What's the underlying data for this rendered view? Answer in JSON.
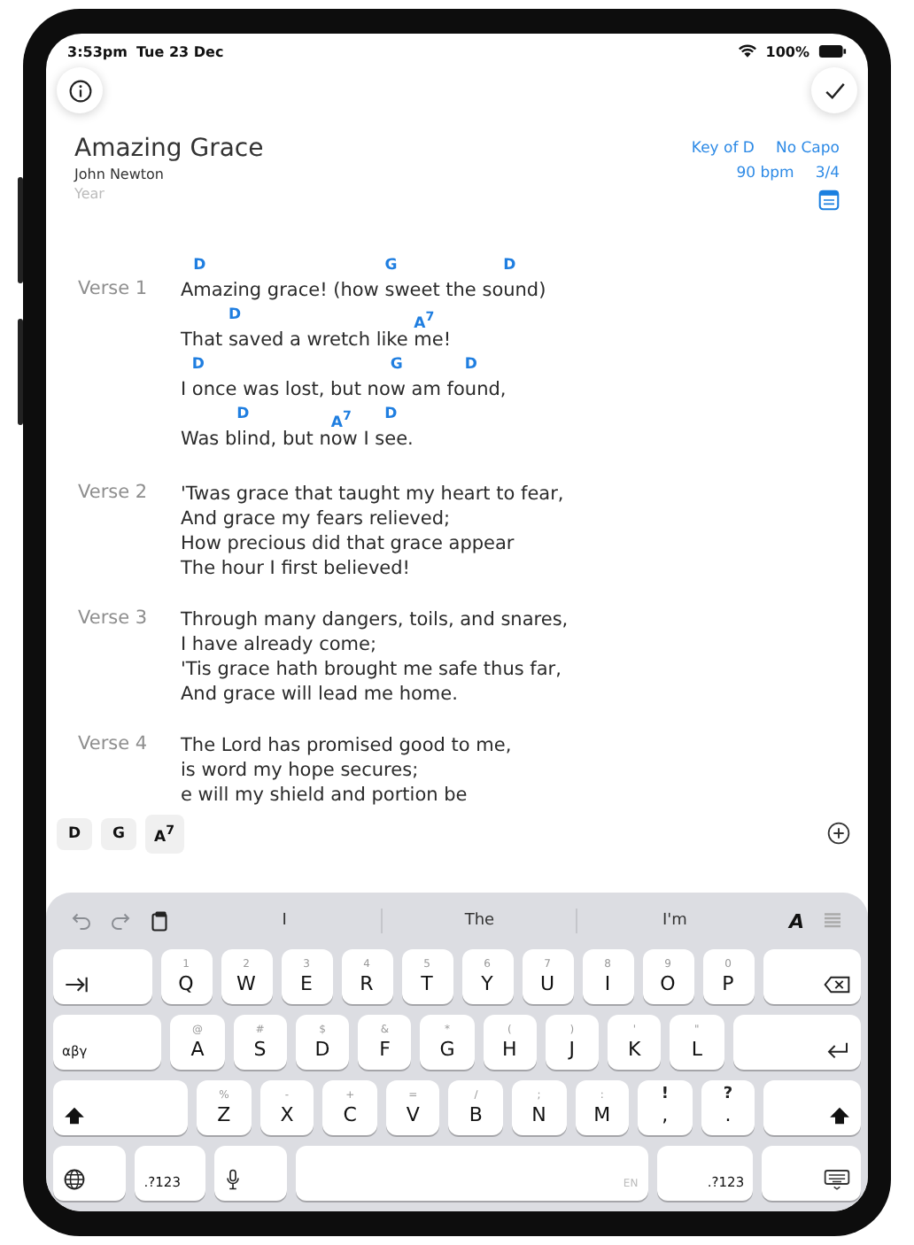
{
  "status_bar": {
    "time": "3:53pm",
    "date": "Tue 23 Dec",
    "battery": "100%"
  },
  "song": {
    "title": "Amazing Grace",
    "author": "John Newton",
    "year": {
      "placeholder": "Year"
    },
    "key": "Key of D",
    "capo": "No Capo",
    "tempo": "90 bpm",
    "time_signature": "3/4"
  },
  "sections": [
    {
      "label": "Verse 1",
      "lines": [
        {
          "segments": [
            {
              "text": "A"
            },
            {
              "chord": "D",
              "text": "mazing grace! (how "
            },
            {
              "chord": "G",
              "text": "sweet the so"
            },
            {
              "chord": "D",
              "text": "und)"
            }
          ]
        },
        {
          "segments": [
            {
              "text": "That "
            },
            {
              "chord": "D",
              "text": "saved a wretch like "
            },
            {
              "chord": "A$^{7}$",
              "text": "me!"
            }
          ]
        },
        {
          "segments": [
            {
              "text": "I "
            },
            {
              "chord": "D",
              "text": "once was lost, but no"
            },
            {
              "chord": "G",
              "text": "w am fo"
            },
            {
              "chord": "D",
              "text": "und,"
            }
          ]
        },
        {
          "segments": [
            {
              "text": "Was b"
            },
            {
              "chord": "D",
              "text": "lind, but n"
            },
            {
              "chord": "A$^{7}$",
              "text": "ow I s"
            },
            {
              "chord": "D",
              "text": "ee."
            }
          ]
        }
      ]
    },
    {
      "label": "Verse 2",
      "lines": [
        {
          "text": "'Twas grace that taught my heart to fear,"
        },
        {
          "text": "And grace my fears relieved;"
        },
        {
          "text": "How precious did that grace appear"
        },
        {
          "text": "The hour I first believed!"
        }
      ]
    },
    {
      "label": "Verse 3",
      "lines": [
        {
          "text": "Through many dangers, toils, and snares,"
        },
        {
          "text": "I have already come;"
        },
        {
          "text": "'Tis grace hath brought me safe thus far,"
        },
        {
          "text": "And grace will lead me home."
        }
      ]
    },
    {
      "label": "Verse 4",
      "lines": [
        {
          "text": "The Lord has promised good to me,"
        },
        {
          "text": "is word my hope secures;"
        },
        {
          "text": "e will my shield and portion be"
        }
      ]
    }
  ],
  "chord_bar": {
    "chords": [
      "D",
      "G",
      "A$^{7}$"
    ]
  },
  "keyboard": {
    "suggestions": [
      "I",
      "The",
      "I'm"
    ],
    "format_label": "A",
    "rows": [
      {
        "keys": [
          {
            "kind": "tab"
          },
          {
            "kind": "letter",
            "label": "Q",
            "alt": "1"
          },
          {
            "kind": "letter",
            "label": "W",
            "alt": "2"
          },
          {
            "kind": "letter",
            "label": "E",
            "alt": "3"
          },
          {
            "kind": "letter",
            "label": "R",
            "alt": "4"
          },
          {
            "kind": "letter",
            "label": "T",
            "alt": "5"
          },
          {
            "kind": "letter",
            "label": "Y",
            "alt": "6"
          },
          {
            "kind": "letter",
            "label": "U",
            "alt": "7"
          },
          {
            "kind": "letter",
            "label": "I",
            "alt": "8"
          },
          {
            "kind": "letter",
            "label": "O",
            "alt": "9"
          },
          {
            "kind": "letter",
            "label": "P",
            "alt": "0"
          },
          {
            "kind": "delete"
          }
        ]
      },
      {
        "keys": [
          {
            "kind": "alphabet",
            "label": "αβγ"
          },
          {
            "kind": "letter",
            "label": "A",
            "alt": "@"
          },
          {
            "kind": "letter",
            "label": "S",
            "alt": "#"
          },
          {
            "kind": "letter",
            "label": "D",
            "alt": "$"
          },
          {
            "kind": "letter",
            "label": "F",
            "alt": "&"
          },
          {
            "kind": "letter",
            "label": "G",
            "alt": "*"
          },
          {
            "kind": "letter",
            "label": "H",
            "alt": "("
          },
          {
            "kind": "letter",
            "label": "J",
            "alt": ")"
          },
          {
            "kind": "letter",
            "label": "K",
            "alt": "'"
          },
          {
            "kind": "letter",
            "label": "L",
            "alt": "\""
          },
          {
            "kind": "return"
          }
        ]
      },
      {
        "keys": [
          {
            "kind": "shift"
          },
          {
            "kind": "letter",
            "label": "Z",
            "alt": "%"
          },
          {
            "kind": "letter",
            "label": "X",
            "alt": "-"
          },
          {
            "kind": "letter",
            "label": "C",
            "alt": "+"
          },
          {
            "kind": "letter",
            "label": "V",
            "alt": "="
          },
          {
            "kind": "letter",
            "label": "B",
            "alt": "/"
          },
          {
            "kind": "letter",
            "label": "N",
            "alt": ";"
          },
          {
            "kind": "letter",
            "label": "M",
            "alt": ":"
          },
          {
            "kind": "punct",
            "label": ",",
            "alt": "!"
          },
          {
            "kind": "punct",
            "label": ".",
            "alt": "?"
          },
          {
            "kind": "shift"
          }
        ]
      },
      {
        "keys": [
          {
            "kind": "globe"
          },
          {
            "kind": "symbols",
            "label": ".?123"
          },
          {
            "kind": "mic"
          },
          {
            "kind": "space",
            "label": "EN"
          },
          {
            "kind": "symbols",
            "label": ".?123"
          },
          {
            "kind": "hide"
          }
        ]
      }
    ]
  }
}
